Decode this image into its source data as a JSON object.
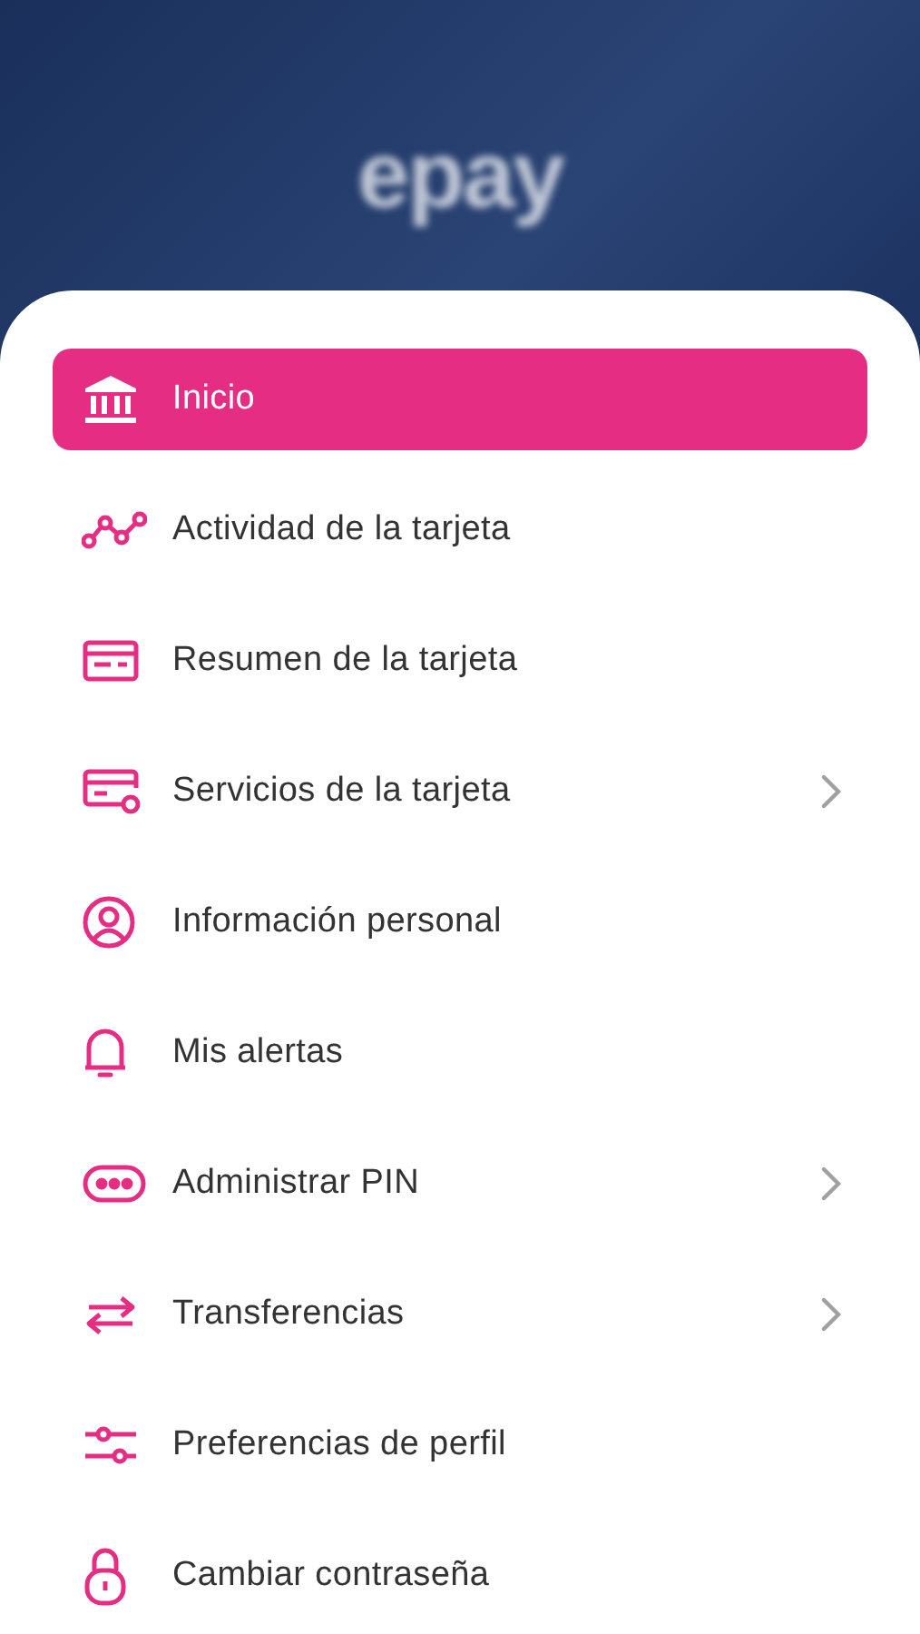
{
  "header": {
    "logo": "epay"
  },
  "menu": [
    {
      "label": "Inicio",
      "selected": true,
      "chevron": false
    },
    {
      "label": "Actividad de la tarjeta",
      "selected": false,
      "chevron": false
    },
    {
      "label": "Resumen de la tarjeta",
      "selected": false,
      "chevron": false
    },
    {
      "label": "Servicios de la tarjeta",
      "selected": false,
      "chevron": true
    },
    {
      "label": "Información personal",
      "selected": false,
      "chevron": false
    },
    {
      "label": "Mis alertas",
      "selected": false,
      "chevron": false
    },
    {
      "label": "Administrar PIN",
      "selected": false,
      "chevron": true
    },
    {
      "label": "Transferencias",
      "selected": false,
      "chevron": true
    },
    {
      "label": "Preferencias de perfil",
      "selected": false,
      "chevron": false
    },
    {
      "label": "Cambiar contraseña",
      "selected": false,
      "chevron": false
    }
  ]
}
